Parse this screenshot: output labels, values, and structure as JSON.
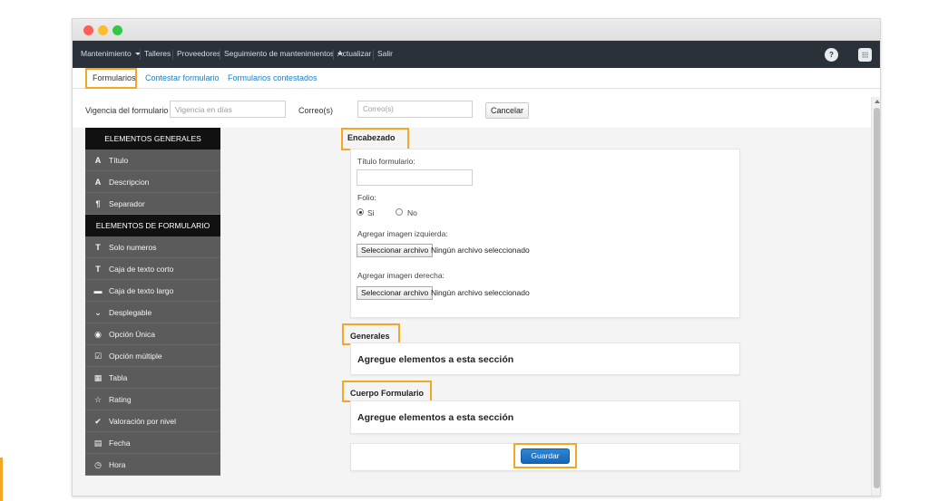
{
  "colors": {
    "navbar": "#2a3139",
    "highlight": "#f5a623",
    "link": "#1d7fc2",
    "sidebar_header": "#111111",
    "sidebar_item": "#5b5b5b",
    "primary_button": "#1766b6",
    "traffic_red": "#fc5f57",
    "traffic_yellow": "#fdbc2e",
    "traffic_green": "#33c748"
  },
  "navbar": {
    "items": [
      "Mantenimiento",
      "Talleres",
      "Proveedores",
      "Seguimiento de mantenimientos",
      "Actualizar",
      "Salir"
    ],
    "help_icon": "question-circle-icon",
    "apps_icon": "grid-icon"
  },
  "tabs": [
    "Formularios",
    "Contestar formulario",
    "Formularios contestados"
  ],
  "filters": {
    "vigencia_label": "Vigencia del formulario",
    "vigencia_placeholder": "Vigencia en días",
    "correo_label": "Correo(s)",
    "correo_placeholder": "Correo(s)",
    "cancel_label": "Cancelar"
  },
  "sidebar": {
    "general_header": "ELEMENTOS GENERALES",
    "general_items": [
      {
        "icon": "A",
        "label": "Título"
      },
      {
        "icon": "A",
        "label": "Descripcion"
      },
      {
        "icon": "¶",
        "label": "Separador"
      }
    ],
    "form_header": "ELEMENTOS DE FORMULARIO",
    "form_items": [
      {
        "icon": "T",
        "label": "Solo numeros"
      },
      {
        "icon": "T",
        "label": "Caja de texto corto"
      },
      {
        "icon": "▬",
        "label": "Caja de texto largo"
      },
      {
        "icon": "⌄",
        "label": "Desplegable"
      },
      {
        "icon": "◉",
        "label": "Opción Única"
      },
      {
        "icon": "☑",
        "label": "Opción múltiple"
      },
      {
        "icon": "▦",
        "label": "Tabla"
      },
      {
        "icon": "☆",
        "label": "Rating"
      },
      {
        "icon": "✔",
        "label": "Valoración por nivel"
      },
      {
        "icon": "▤",
        "label": "Fecha"
      },
      {
        "icon": "◷",
        "label": "Hora"
      }
    ]
  },
  "encabezado": {
    "title": "Encabezado",
    "titulo_label": "Título formulario:",
    "folio_label": "Folio:",
    "si_label": "Si",
    "no_label": "No",
    "img_left_label": "Agregar imagen izquierda:",
    "img_right_label": "Agregar imagen derecha:",
    "file_button": "Seleccionar archivo",
    "no_file": "Ningún archivo seleccionado"
  },
  "generales": {
    "title": "Generales",
    "placeholder": "Agregue elementos a esta sección"
  },
  "cuerpo": {
    "title": "Cuerpo Formulario",
    "placeholder": "Agregue elementos a esta sección"
  },
  "save_label": "Guardar"
}
